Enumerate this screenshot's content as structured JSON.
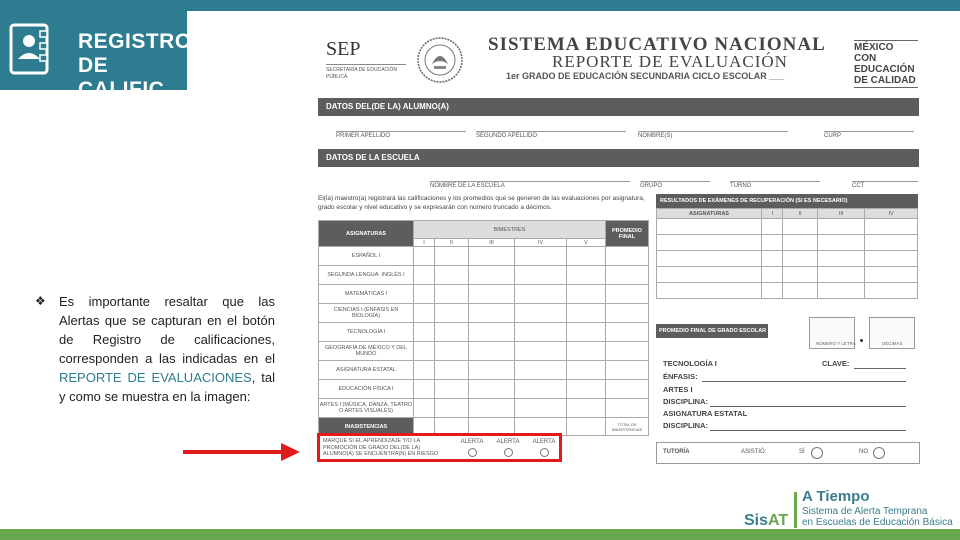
{
  "logo": {
    "line1": "REGISTRO",
    "line2": "DE CALIFIC."
  },
  "note": {
    "bullet": "❖",
    "text_before": "Es importante resaltar que las Alertas que se capturan en el botón de Registro de calificaciones, corresponden a las indicadas en el ",
    "highlight": "REPORTE DE EVALUACIONES",
    "text_after": ", tal y como se muestra en la imagen:"
  },
  "form": {
    "sep": {
      "title": "SEP",
      "subtitle": "SECRETARÍA DE EDUCACIÓN PÚBLICA"
    },
    "title": "SISTEMA EDUCATIVO NACIONAL",
    "subtitle": "REPORTE DE EVALUACIÓN",
    "grade_line": "1er GRADO DE EDUCACIÓN SECUNDARIA    CICLO ESCOLAR ___",
    "mexico": {
      "l1": "MÉXICO CON",
      "l2": "EDUCACIÓN",
      "l3": "DE CALIDAD"
    },
    "band_student": "DATOS DEL(DE LA) ALUMNO(A)",
    "student_fields": [
      "PRIMER APELLIDO",
      "SEGUNDO APELLIDO",
      "NOMBRE(S)",
      "CURP"
    ],
    "band_school": "DATOS DE LA ESCUELA",
    "school_fields": [
      "NOMBRE DE LA ESCUELA",
      "GRUPO",
      "TURNO",
      "CCT"
    ],
    "intro": "El(la) maestro(a) registrará las calificaciones y los promedios que se generen de las evaluaciones por asignatura, grado escolar y nivel educativo y se expresarán con número truncado a décimos.",
    "table_headers": {
      "asignaturas": "ASIGNATURAS",
      "bimestres": "BIMESTRES",
      "promedio": "PROMEDIO FINAL"
    },
    "bimestres": [
      "I",
      "II",
      "III",
      "IV",
      "V"
    ],
    "subjects": [
      "ESPAÑOL I",
      "SEGUNDA LENGUA: INGLÉS I",
      "MATEMÁTICAS I",
      "CIENCIAS I (ÉNFASIS EN BIOLOGÍA)",
      "TECNOLOGÍA I",
      "GEOGRAFÍA DE MÉXICO Y DEL MUNDO",
      "ASIGNATURA ESTATAL",
      "EDUCACIÓN FÍSICA I",
      "ARTES I (MÚSICA, DANZA, TEATRO O ARTES VISUALES)"
    ],
    "inasistencias": "INASISTENCIAS",
    "total_inasistencias": "TOTAL DE INASISTENCIAS",
    "alert_text": "MARQUE SI EL APRENDIZAJE Y/O LA PROMOCIÓN DE GRADO DEL(DE LA) ALUMNO(A) SE ENCUENTRA(N) EN RIESGO",
    "alert_cols": [
      "ALERTA",
      "ALERTA",
      "ALERTA"
    ],
    "recovery_header": "RESULTADOS DE EXÁMENES DE RECUPERACIÓN (SI ES NECESARIO)",
    "recovery_cols": [
      "ASIGNATURAS",
      "I",
      "II",
      "III",
      "IV"
    ],
    "promedio_final": "PROMEDIO FINAL DE GRADO ESCOLAR",
    "promedio_caps": [
      "NÚMERO Y LETRA",
      "DÉCIMAS"
    ],
    "tech": {
      "tecnologia": "TECNOLOGÍA I",
      "clave": "CLAVE:",
      "enfasis": "ÉNFASIS:",
      "artes": "ARTES I",
      "disciplina": "DISCIPLINA:",
      "asig_estatal": "ASIGNATURA ESTATAL",
      "disciplina2": "DISCIPLINA:"
    },
    "tutoria": {
      "label": "TUTORÍA",
      "asistio": "ASISTIÓ:",
      "si": "SÍ",
      "no": "NO"
    }
  },
  "sisat": {
    "brand_a": "Sis",
    "brand_b": "AT",
    "headline": "A Tiempo",
    "line1": "Sistema de Alerta Temprana",
    "line2": "en Escuelas de Educación Básica"
  },
  "colors": {
    "teal": "#2e7c8f",
    "green": "#6aa84f",
    "alert_red": "#e01b1b",
    "band_gray": "#5d5d5d"
  }
}
